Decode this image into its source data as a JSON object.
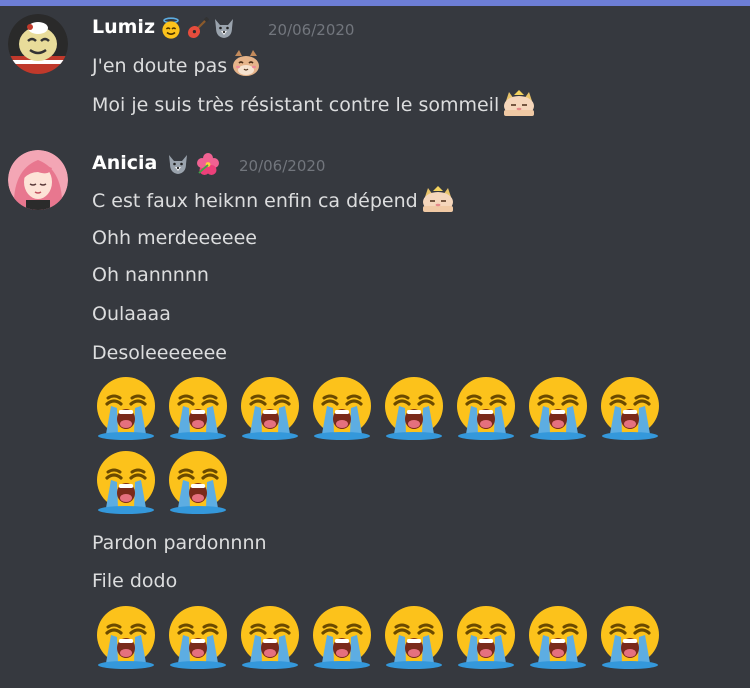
{
  "messages": [
    {
      "author": "Lumiz",
      "timestamp": "20/06/2020",
      "badges": [
        "smiling-face-with-halo",
        "guitar",
        "wolf-face"
      ],
      "lines": [
        "J'en doute pas",
        "Moi je suis très résistant contre le sommeil"
      ]
    },
    {
      "author": "Anicia",
      "timestamp": "20/06/2020",
      "badges": [
        "wolf-face",
        "hibiscus"
      ],
      "lines": [
        "C est faux heiknn enfin ca dépend",
        "Ohh merdeeeeee",
        "Oh nannnnn",
        "Oulaaaa",
        "Desoleeeeeee",
        "Pardon pardonnnn",
        "File dodo"
      ],
      "jumbo_emoji": "loudly-crying-face",
      "jumbo_rows": [
        8,
        2,
        8
      ]
    }
  ],
  "colors": {
    "background": "#36393f",
    "username": "#ffffff",
    "text": "#dcddde",
    "timestamp": "#72767d",
    "top_strip": "#6d7ed6"
  }
}
